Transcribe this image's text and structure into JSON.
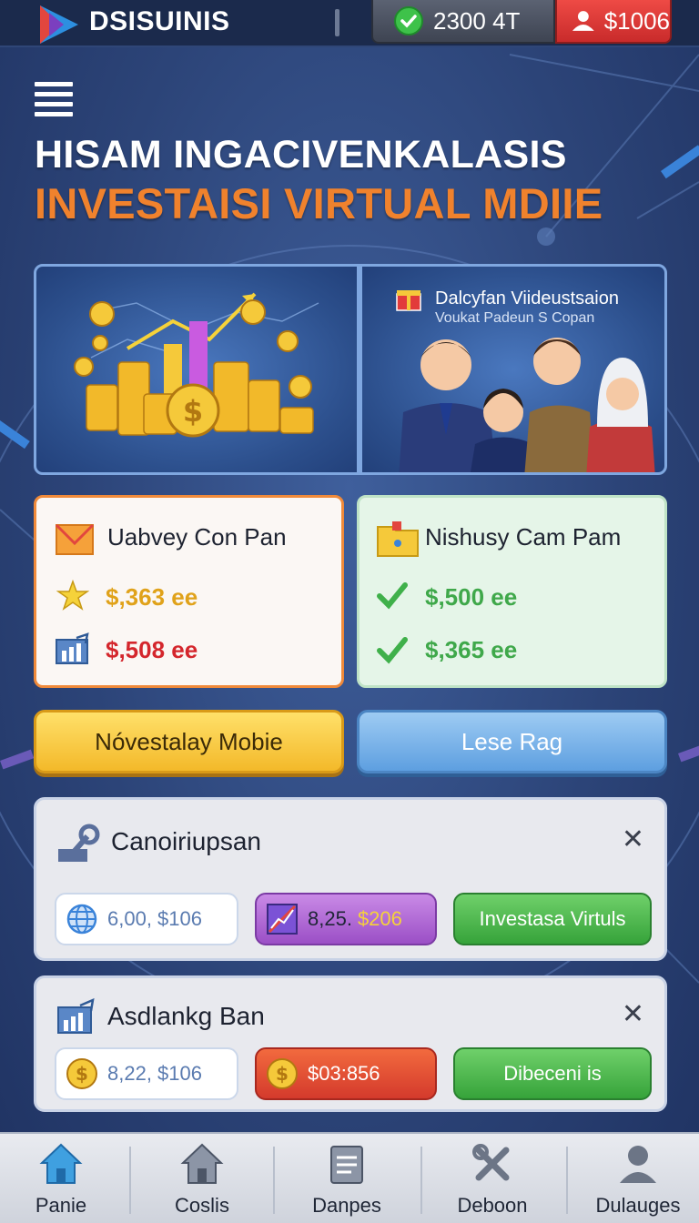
{
  "header": {
    "brand": "DSISUINIS",
    "coins": "2300 4T",
    "cash": "$1006"
  },
  "hero": {
    "headline": "HISAM INGACIVENKALASIS",
    "subheadline": "INVESTAISI VIRTUAL MDIIE"
  },
  "banner_right": {
    "title": "Dalcyfan Viidеustsaion",
    "subtitle": "Voukat Padeun S Copan"
  },
  "card_left": {
    "title": "Uabvey Con Pan",
    "row1": "$,363 ee",
    "row2": "$,508 ee"
  },
  "card_right": {
    "title": "Nishusy Cam Pam",
    "row1": "$,500 ee",
    "row2": "$,365 ee"
  },
  "buttons": {
    "primary": "Nóvestalay Mobie",
    "secondary": "Lese Rag"
  },
  "panel1": {
    "title": "Canoiriupsan",
    "pill1": "6,00, $106",
    "pill2_prefix": "8,25.",
    "pill2_value": "$206",
    "action": "Investasa Virtuls"
  },
  "panel2": {
    "title": "Asdlankg Ban",
    "pill1": "8,22, $106",
    "pill2": "$03:856",
    "action": "Dibeceni is"
  },
  "nav": [
    {
      "label": "Panie",
      "icon": "home-icon"
    },
    {
      "label": "Coslis",
      "icon": "house-icon"
    },
    {
      "label": "Danpes",
      "icon": "document-icon"
    },
    {
      "label": "Deboon",
      "icon": "tools-icon"
    },
    {
      "label": "Dulauges",
      "icon": "user-icon"
    }
  ],
  "colors": {
    "accent_orange": "#f0822d",
    "background": "#2c4478",
    "cash_red": "#e0403b",
    "action_green": "#36a33a"
  }
}
